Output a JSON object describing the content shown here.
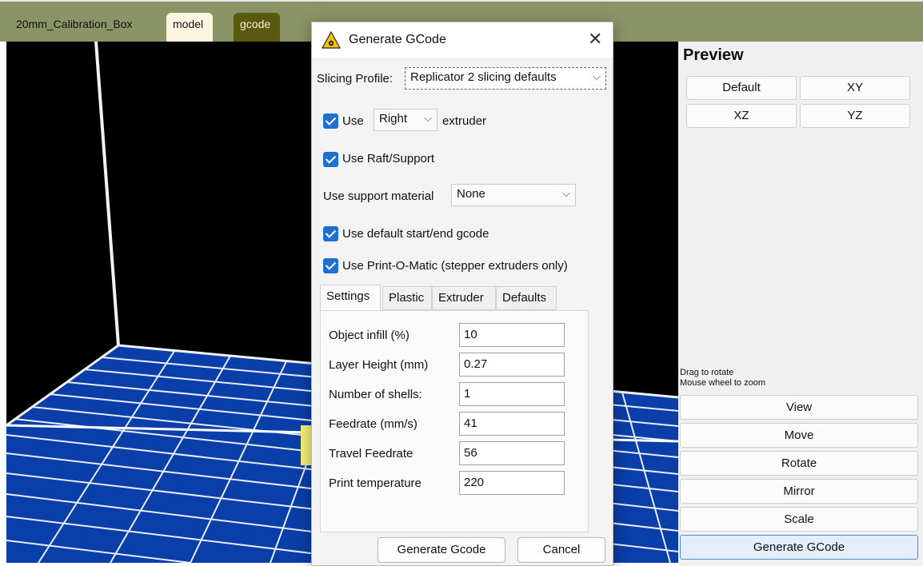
{
  "tabs": {
    "file_name": "20mm_Calibration_Box",
    "model": "model",
    "gcode": "gcode"
  },
  "colors": {
    "tabbar": "#8b9466",
    "grid_blue": "#0a3ea8",
    "grid_line": "#e8eef8",
    "yellow_object": "#f4f07a",
    "accent": "#1f6fd1"
  },
  "dialog": {
    "title": "Generate GCode",
    "title_icon": "warning-icon",
    "close_icon": "close-icon",
    "slicing_profile_label": "Slicing Profile:",
    "slicing_profile_value": "Replicator 2 slicing defaults",
    "use_label": "Use",
    "extruder_value": "Right",
    "extruder_label": "extruder",
    "use_raft": "Use Raft/Support",
    "support_material_label": "Use support material",
    "support_material_value": "None",
    "default_gcode": "Use default start/end gcode",
    "print_o_matic": "Use Print-O-Matic (stepper extruders only)",
    "tabs": [
      "Settings",
      "Plastic",
      "Extruder",
      "Defaults"
    ],
    "fields": [
      {
        "label": "Object infill (%)",
        "value": "10"
      },
      {
        "label": "Layer Height (mm)",
        "value": "0.27"
      },
      {
        "label": "Number of shells:",
        "value": "1"
      },
      {
        "label": "Feedrate (mm/s)",
        "value": "41"
      },
      {
        "label": "Travel Feedrate",
        "value": "56"
      },
      {
        "label": "Print temperature",
        "value": "220"
      }
    ],
    "generate_button": "Generate Gcode",
    "cancel_button": "Cancel"
  },
  "panel": {
    "title": "Preview",
    "view_buttons": [
      "Default",
      "XY",
      "XZ",
      "YZ"
    ],
    "hint_rotate": "Drag to rotate",
    "hint_zoom": "Mouse wheel to zoom",
    "side_buttons": [
      "View",
      "Move",
      "Rotate",
      "Mirror",
      "Scale",
      "Generate GCode"
    ]
  }
}
